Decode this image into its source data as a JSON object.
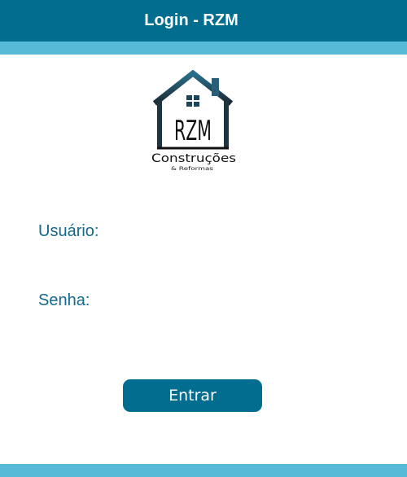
{
  "header": {
    "title": "Login - RZM"
  },
  "logo": {
    "letters": "RZM",
    "name": "Construções",
    "tagline": "& Reformas",
    "icon": "house-icon"
  },
  "form": {
    "username_label": "Usuário:",
    "username_value": "",
    "password_label": "Senha:",
    "password_value": ""
  },
  "actions": {
    "login_label": "Entrar"
  },
  "colors": {
    "header": "#036d8f",
    "stripe": "#56b9d6",
    "label_text": "#12698a",
    "button": "#036d8f"
  }
}
